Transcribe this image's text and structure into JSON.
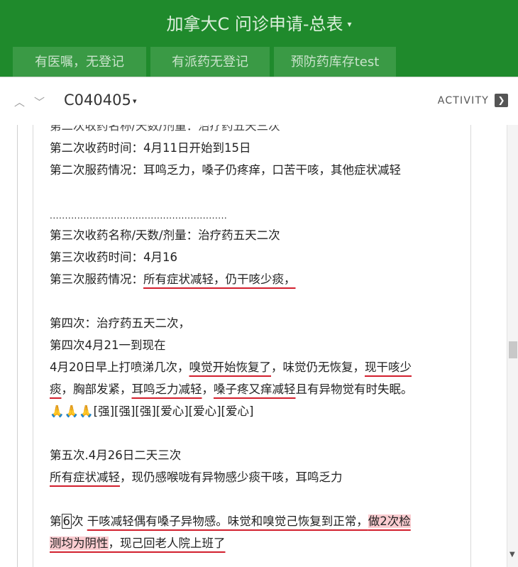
{
  "header": {
    "title": "加拿大C 问诊申请-总表",
    "title_caret": "▾",
    "tabs": [
      "有医嘱，无登记",
      "有派药无登记",
      "预防药库存test"
    ]
  },
  "toolbar": {
    "up_arrow": "︿",
    "down_arrow": "﹀",
    "card_code": "C040405",
    "card_caret": "▾",
    "activity_label": "ACTIVITY",
    "activity_icon": "❯"
  },
  "content": {
    "line_cut": "第二次收药名称/天数/剂量：治疗药五天三次",
    "line1": "第二次收药时间：4月11日开始到15日",
    "line2": "第二次服药情况：耳鸣乏力，嗓子仍疼痒，口苦干咳，其他症状减轻",
    "dots": "..........................................................",
    "line3": "第三次收药名称/天数/剂量：治疗药五天二次",
    "line4": "第三次收药时间：4月16",
    "line5_a": "第三次服药情况：",
    "line5_b": "所有症状减轻，仍干咳少痰，",
    "line6": "第四次：治疗药五天二次，",
    "line7": "第四次4月21一到现在",
    "line8_a": "4月20日早上打喷涕几次，",
    "line8_b": "嗅觉开始恢复了",
    "line8_c": "，味觉仍无恢复，",
    "line8_d": "现干咳少",
    "line9_a": "痰",
    "line9_b": "，胸部发紧，",
    "line9_c": "耳鸣乏力减轻",
    "line9_d": "，",
    "line9_e": "嗓子疼又痒减轻",
    "line9_f": "且有异物觉有时失眠。",
    "line10_emoji": "🙏🙏🙏",
    "line10_text": "[强][强][强][爱心][爱心][爱心]",
    "line11": "第五次.4月26日二天三次",
    "line12_a": "所有症状减轻",
    "line12_b": "，现仍感喉咙有异物感少痰干咳，耳鸣乏力",
    "line13_a": "第",
    "line13_box": "6",
    "line13_b": "次",
    "line13_c": "干咳减轻偶有嗓子异物感。味觉和嗅觉己恢复到正常，",
    "line13_d": "做2次检",
    "line14_a": "测均为阴性",
    "line14_b": "，现己回老人院上班了"
  },
  "colors": {
    "header_green": "#1f8a2c",
    "tab_green": "#3a9a45",
    "underline_red": "#d21f2d",
    "highlight_pink": "rgba(240,110,120,0.35)"
  }
}
